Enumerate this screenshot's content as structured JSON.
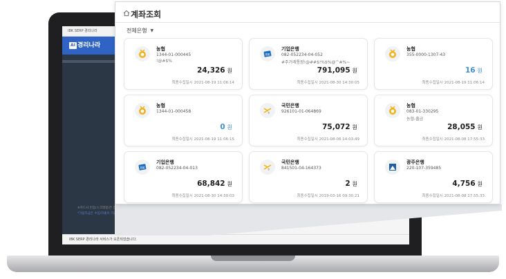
{
  "laptop_app": {
    "topbar_text": "IBK SERP 경리나라",
    "brand": "경리나라",
    "brand_badge": "AI",
    "notice_lines": [
      "※카드사 인증(스크래핑)은 은행/카드사 홈페이지에서 신규 등록 후 이용하실 수 있습니다. 공인인증서 및 통장 정보는 안전하게 보관됩니다.",
      "*가용자금은 수입/지출이 가능한 실제 통장 가능한 금액입니다."
    ],
    "status_text": "IBK SERP 경리나라 서비스가 오픈되었습니다."
  },
  "panel": {
    "title": "계좌조회",
    "filter_label": "전체은행"
  },
  "accounts": [
    {
      "bank": "농협",
      "logo": "nh-bank-icon",
      "account": "1344-01-000445",
      "memo": "!@#$%",
      "amount": "24,326",
      "unit": "원",
      "updated": "최종수집일시 2021-08-19 11:06:14"
    },
    {
      "bank": "기업은행",
      "logo": "ibk-bank-icon",
      "account": "082-052234-04-052",
      "memo": "#주거래통장!@##$!%$%@^#%~",
      "amount": "791,095",
      "unit": "원",
      "updated": "최종수집일시 2021-08-30 14:30:05"
    },
    {
      "bank": "농협",
      "logo": "nh-bank-icon",
      "account": "355-0000-1307-43",
      "memo": "",
      "amount": "16",
      "unit": "원",
      "updated": "최종수집일시 2021-08-19 11:06:14"
    },
    {
      "bank": "농협",
      "logo": "nh-bank-icon",
      "account": "1344-01-000458",
      "memo": "",
      "amount": "0",
      "unit": "원",
      "updated": "최종수집일시 2021-08-19 11:06:15"
    },
    {
      "bank": "국민은행",
      "logo": "kb-bank-icon",
      "account": "926101-01-064869",
      "memo": "",
      "amount": "75,072",
      "unit": "원",
      "updated": "최종수집일시 2021-08-06 14:03:49"
    },
    {
      "bank": "농협",
      "logo": "nh-bank-icon",
      "account": "083-01-330295",
      "memo": "농협-출금",
      "amount": "28,055",
      "unit": "원",
      "updated": "최종수집일시 2021-08-08 17:55:33"
    },
    {
      "bank": "기업은행",
      "logo": "ibk-bank-icon",
      "account": "082-052234-04-013",
      "memo": "",
      "amount": "68,842",
      "unit": "원",
      "updated": "최종수집일시 2021-08-30 14:30:03"
    },
    {
      "bank": "국민은행",
      "logo": "kb-bank-icon",
      "account": "841501-04-164373",
      "memo": "",
      "amount": "2",
      "unit": "원",
      "updated": "최종수집일시 2019-03-16 09:30:21"
    },
    {
      "bank": "광주은행",
      "logo": "kj-bank-icon",
      "account": "220-107-359485",
      "memo": "",
      "amount": "4,756",
      "unit": "원",
      "updated": "최종수집일시 2021-08-08 17:55:33"
    }
  ],
  "colors": {
    "accent_blue": "#3d8fd6",
    "brand_blue": "#2f64c4",
    "nh_yellow": "#f2b21c",
    "ibk_blue": "#1f6fc1",
    "kb_yellow": "#f5b400"
  }
}
